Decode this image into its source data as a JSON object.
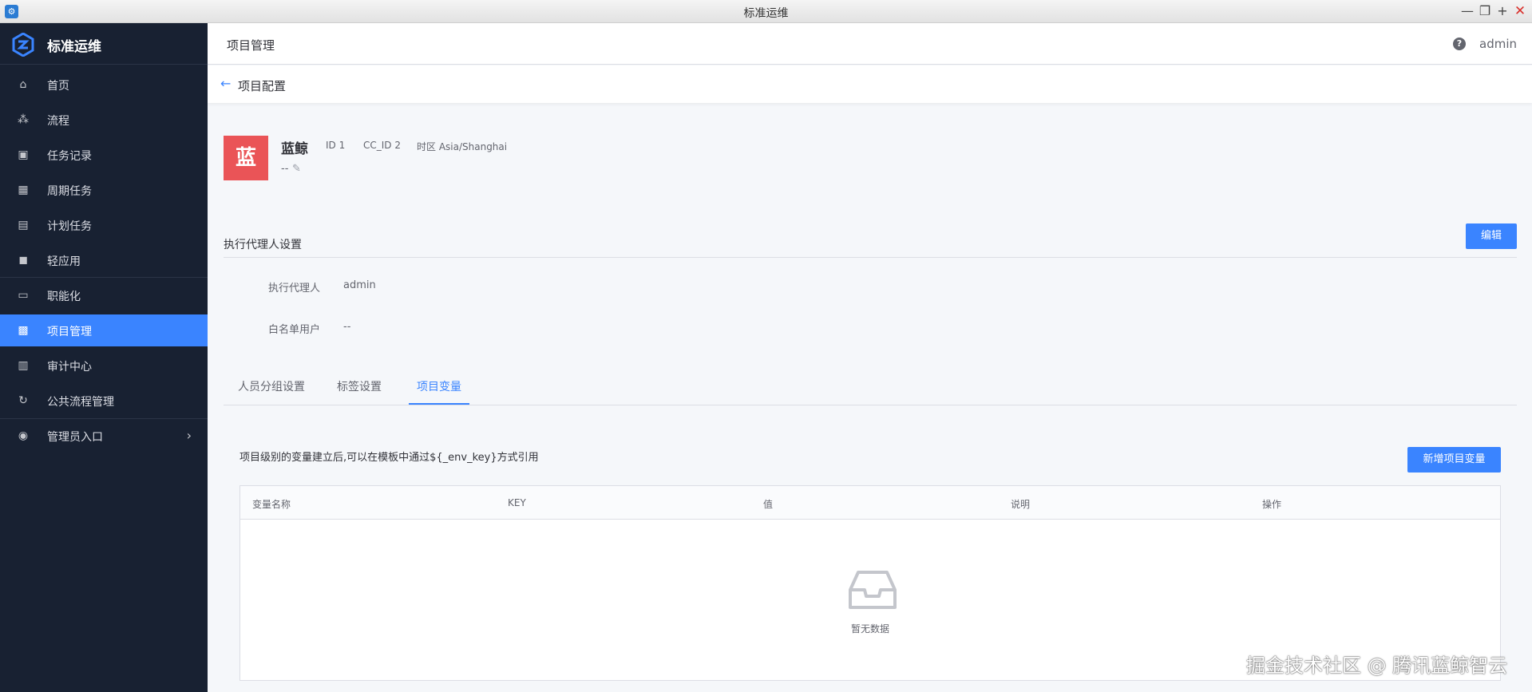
{
  "window": {
    "title": "标准运维",
    "app_icon": "gear-app-icon"
  },
  "sidebar": {
    "brand": "标准运维",
    "items": [
      {
        "label": "首页",
        "icon": "home-icon"
      },
      {
        "label": "流程",
        "icon": "flow-icon"
      },
      {
        "label": "任务记录",
        "icon": "bookmark-icon"
      },
      {
        "label": "周期任务",
        "icon": "calendar-icon"
      },
      {
        "label": "计划任务",
        "icon": "schedule-icon"
      },
      {
        "label": "轻应用",
        "icon": "apps-icon"
      },
      {
        "label": "职能化",
        "icon": "function-icon"
      },
      {
        "label": "项目管理",
        "icon": "project-icon",
        "active": true
      },
      {
        "label": "审计中心",
        "icon": "audit-icon"
      },
      {
        "label": "公共流程管理",
        "icon": "cycle-icon"
      },
      {
        "label": "管理员入口",
        "icon": "user-circle-icon"
      }
    ]
  },
  "header": {
    "title": "项目管理",
    "user": "admin"
  },
  "subheader": {
    "title": "项目配置"
  },
  "project": {
    "avatar": "蓝",
    "name": "蓝鲸",
    "id": "ID 1",
    "cc_id": "CC_ID 2",
    "timezone": "时区 Asia/Shanghai",
    "desc": "--"
  },
  "agent_section": {
    "title": "执行代理人设置",
    "edit_label": "编辑",
    "agent_label": "执行代理人",
    "agent_value": "admin",
    "whitelist_label": "白名单用户",
    "whitelist_value": "--"
  },
  "tabs": [
    {
      "label": "人员分组设置"
    },
    {
      "label": "标签设置"
    },
    {
      "label": "项目变量",
      "active": true
    }
  ],
  "variables": {
    "tip": "项目级别的变量建立后,可以在模板中通过${_env_key}方式引用",
    "add_label": "新增项目变量",
    "columns": [
      "变量名称",
      "KEY",
      "值",
      "说明",
      "操作"
    ],
    "empty_text": "暂无数据"
  },
  "watermark": "掘金技术社区 @ 腾讯蓝鲸智云",
  "colors": {
    "accent": "#3a84ff",
    "sidebar": "#182132",
    "avatar": "#ea5457"
  }
}
